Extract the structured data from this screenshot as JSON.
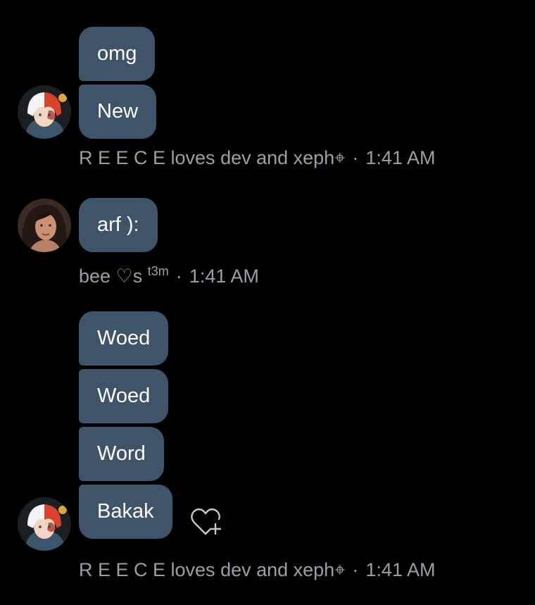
{
  "messages_group_1": {
    "bubbles": [
      "omg",
      "New"
    ],
    "sender": "R E E C E loves dev and xeph⌖",
    "time": "1:41 AM"
  },
  "messages_group_2": {
    "bubbles": [
      "arf ):"
    ],
    "sender": "bee ♡s",
    "sender_sup": "t3m",
    "time": "1:41 AM"
  },
  "messages_group_3": {
    "bubbles": [
      "Woed",
      "Woed",
      "Word",
      "Bakak"
    ],
    "sender": "R E E C E loves dev and xeph⌖",
    "time": "1:41 AM"
  },
  "separator": "·",
  "icons": {
    "avatar_1": "anime-character-avatar",
    "avatar_2": "user-photo-avatar",
    "react": "heart-plus-icon"
  },
  "colors": {
    "background": "#000000",
    "bubble": "#3f5468",
    "meta_text": "#9aa0a6"
  }
}
